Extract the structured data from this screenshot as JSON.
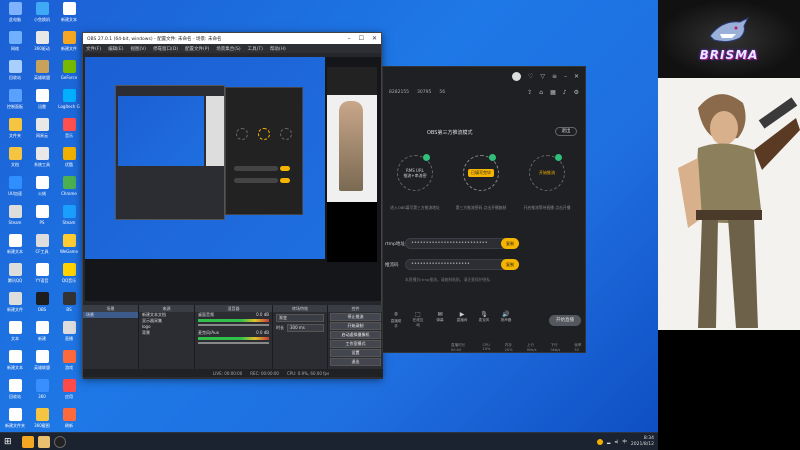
{
  "desktop": {
    "icons": [
      {
        "label": "此电脑",
        "color": "#7fb3ff"
      },
      {
        "label": "小鱼换机",
        "color": "#3fa9f5"
      },
      {
        "label": "新建文本",
        "color": "#ffffff"
      },
      {
        "label": "网络",
        "color": "#6fb1ff"
      },
      {
        "label": "360驱动",
        "color": "#e8e8e8"
      },
      {
        "label": "新建文件",
        "color": "#f5a623"
      },
      {
        "label": "回收站",
        "color": "#a9cfff"
      },
      {
        "label": "英雄联盟",
        "color": "#c8a25a"
      },
      {
        "label": "GeForce",
        "color": "#76b900"
      },
      {
        "label": "控制面板",
        "color": "#5aa0ff"
      },
      {
        "label": "迅雷",
        "color": "#ffffff"
      },
      {
        "label": "Logitech G",
        "color": "#00b0ff"
      },
      {
        "label": "文件夹",
        "color": "#f5c542"
      },
      {
        "label": "网易云",
        "color": "#e8e8e8"
      },
      {
        "label": "音乐",
        "color": "#ff5050"
      },
      {
        "label": "文档",
        "color": "#f5c542"
      },
      {
        "label": "系统工具",
        "color": "#e8e8e8"
      },
      {
        "label": "优酷",
        "color": "#f0b000"
      },
      {
        "label": "UU加速",
        "color": "#2f8fff"
      },
      {
        "label": "火绒",
        "color": "#ffffff"
      },
      {
        "label": "Chrome",
        "color": "#4caf50"
      },
      {
        "label": "Steam",
        "color": "#dddddd"
      },
      {
        "label": "PS",
        "color": "#ffffff"
      },
      {
        "label": "Steam",
        "color": "#1a9fff"
      },
      {
        "label": "新建文本",
        "color": "#ffffff"
      },
      {
        "label": "CF工具",
        "color": "#dddddd"
      },
      {
        "label": "WeGame",
        "color": "#ffcc33"
      },
      {
        "label": "腾讯QQ",
        "color": "#dddddd"
      },
      {
        "label": "YY语音",
        "color": "#ffffff"
      },
      {
        "label": "QQ音乐",
        "color": "#ffd200"
      },
      {
        "label": "新建文件",
        "color": "#dddddd"
      },
      {
        "label": "OBS",
        "color": "#1d1d1d"
      },
      {
        "label": "BS",
        "color": "#333333"
      },
      {
        "label": "文本",
        "color": "#ffffff"
      },
      {
        "label": "新建",
        "color": "#ffffff"
      },
      {
        "label": "直播",
        "color": "#dddddd"
      },
      {
        "label": "新建文本",
        "color": "#ffffff"
      },
      {
        "label": "英雄联盟",
        "color": "#ffffff"
      },
      {
        "label": "游戏",
        "color": "#ff6a3d"
      },
      {
        "label": "回收站",
        "color": "#ffffff"
      },
      {
        "label": "360",
        "color": "#3a8fff"
      },
      {
        "label": "应用",
        "color": "#ff4a4a"
      },
      {
        "label": "新建文件夹",
        "color": "#ffffff"
      },
      {
        "label": "360截图",
        "color": "#f5c542"
      },
      {
        "label": "刷新",
        "color": "#ff6a3d"
      },
      {
        "label": "小工具",
        "color": "#4caf50"
      }
    ]
  },
  "obs": {
    "title": "OBS 27.0.1 (64-bit, windows) - 配置文件: 未命名 - 场景: 未命名",
    "menu": [
      "文件(F)",
      "编辑(E)",
      "视图(V)",
      "停靠窗口(D)",
      "配置文件(P)",
      "场景集合(S)",
      "工具(T)",
      "帮助(H)"
    ],
    "scenes_header": "场景",
    "scenes": [
      "场景"
    ],
    "sources_header": "来源",
    "sources": [
      "新建文本文档",
      "显示器采集",
      "logo",
      "背景"
    ],
    "mixer_header": "混音器",
    "mixer": [
      {
        "name": "桌面音频",
        "db": "0.0 dB"
      },
      {
        "name": "麦克风/Aux",
        "db": "0.0 dB"
      }
    ],
    "transitions_header": "转场特效",
    "transition_value": "渐变",
    "duration_label": "时长",
    "duration_value": "300 ms",
    "controls_header": "控件",
    "controls": [
      "停止推流",
      "开始录制",
      "启动虚拟摄像机",
      "工作室模式",
      "设置",
      "退出"
    ],
    "status": {
      "live": "LIVE: 00:00:00",
      "rec": "REC: 00:00:00",
      "cpu": "CPU: 0.9%, 60.00 fps"
    }
  },
  "live": {
    "stats": {
      "followers": "8282155",
      "views": "30795",
      "hot": "56"
    },
    "mode_title": "OBS第三方推流模式",
    "exit": "退出",
    "steps": [
      {
        "label": "RMS URL",
        "sub": "推流+串流密",
        "desc": "进入OBS填写第三方推流地址"
      },
      {
        "label": "已填写完毕",
        "sub": "",
        "desc": "第三方推流密码 点击开播复制"
      },
      {
        "label": "开始推流",
        "sub": "",
        "desc": "开启推流等待直播 点击开播"
      }
    ],
    "rtmp_label": "rtmp地址",
    "rtmp_value": "••••••••••••••••••••••••••",
    "key_label": "推流码",
    "key_value": "••••••••••••••••••••",
    "copy": "复制",
    "hint": "本直播为rtmp推流，请复制粘贴，请注意保护隐私",
    "tools": [
      {
        "icon": "⌾",
        "label": "直播助手"
      },
      {
        "icon": "⬚",
        "label": "在线互动"
      },
      {
        "icon": "✉",
        "label": "弹幕"
      },
      {
        "icon": "▶",
        "label": "直播间"
      },
      {
        "icon": "🎙",
        "label": "麦克风"
      },
      {
        "icon": "🔊",
        "label": "扬声器"
      }
    ],
    "start": "开始直播",
    "footer": [
      "直播时长 00:00",
      "CPU 10%",
      "内存 20%",
      "上行 0kb/s",
      "下行 0kb/s",
      "帧率 30"
    ]
  },
  "taskbar": {
    "time": "8:34",
    "date": "2021/8/12"
  },
  "brand": {
    "name": "BRISMA"
  }
}
